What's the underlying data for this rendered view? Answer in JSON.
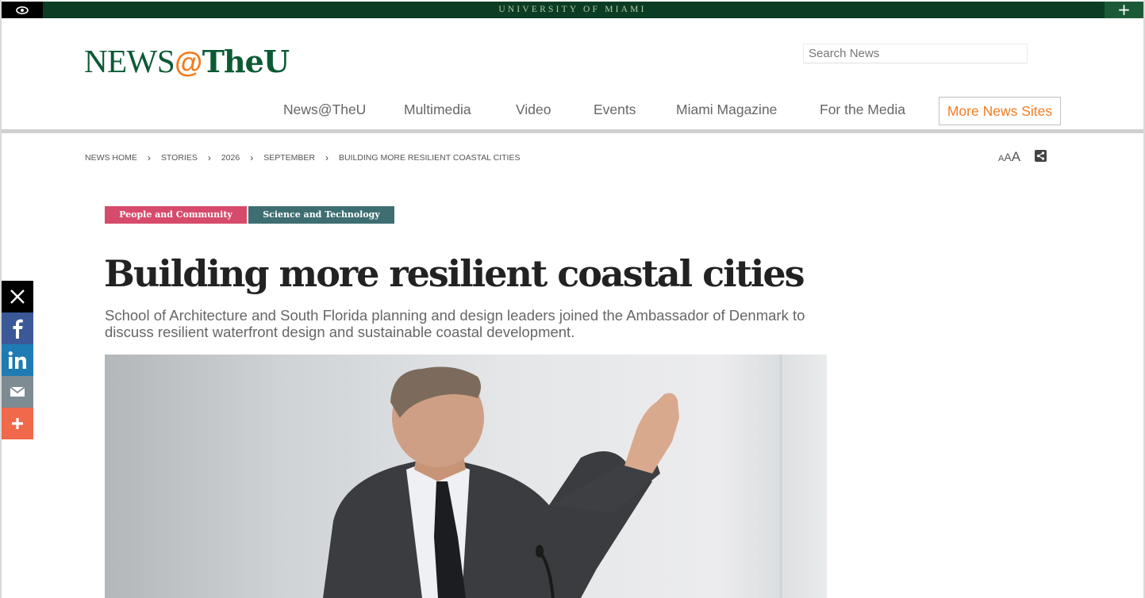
{
  "topbar": {
    "brand": "UNIVERSITY OF MIAMI",
    "plus_label": "+"
  },
  "logo": {
    "part1": "NEWS",
    "part2": "@",
    "part3": "TheU"
  },
  "search": {
    "placeholder": "Search News"
  },
  "nav": {
    "items": [
      {
        "label": "News@TheU"
      },
      {
        "label": "Multimedia"
      },
      {
        "label": "Video"
      },
      {
        "label": "Events"
      },
      {
        "label": "Miami Magazine"
      },
      {
        "label": "For the Media"
      }
    ],
    "more_label": "More News Sites"
  },
  "breadcrumb": {
    "items": [
      "NEWS HOME",
      "STORIES",
      "2026",
      "SEPTEMBER",
      "BUILDING MORE RESILIENT COASTAL CITIES"
    ],
    "separator": "›"
  },
  "text_size": {
    "small": "A",
    "medium": "A",
    "large": "A"
  },
  "tags": [
    "People and Community",
    "Science and Technology"
  ],
  "article": {
    "title": "Building more resilient coastal cities",
    "subtitle": "School of Architecture and South Florida planning and design leaders joined the Ambassador of Denmark to discuss resilient waterfront design and sustainable coastal development."
  },
  "social": {
    "icons": [
      "x-icon",
      "facebook-icon",
      "linkedin-icon",
      "email-icon",
      "more-share-icon"
    ]
  },
  "colors": {
    "um_green": "#0b3d24",
    "logo_green": "#0b5a34",
    "accent_orange": "#f47c20",
    "tag_people": "#d64a6b",
    "tag_science": "#3e6e72"
  }
}
